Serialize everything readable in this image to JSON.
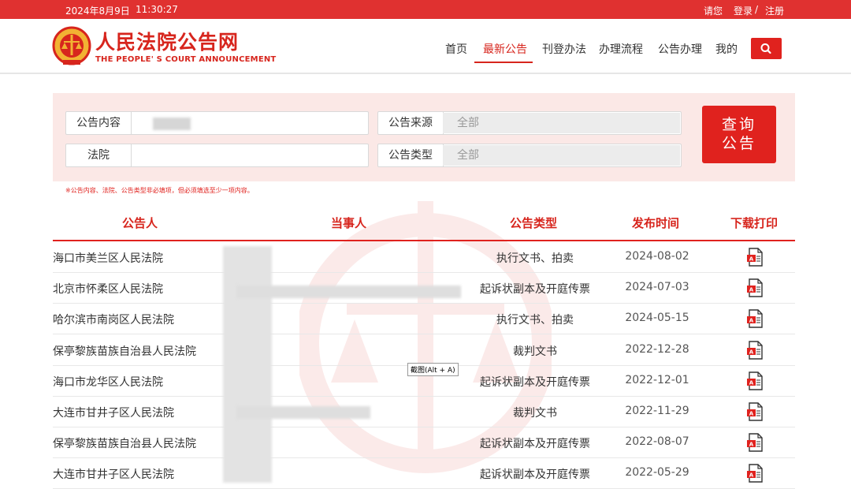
{
  "topbar": {
    "date": "2024年8月9日",
    "time": "11:30:27",
    "greeting": "请您",
    "login": "登录",
    "separator": "/",
    "register": "注册"
  },
  "brand": {
    "title": "人民法院公告网",
    "subtitle": "THE PEOPLE' S COURT ANNOUNCEMENT",
    "color": "#d7251d"
  },
  "nav": {
    "items": [
      "首页",
      "最新公告",
      "刊登办法",
      "办理流程",
      "公告办理",
      "我的"
    ],
    "active_index": 1
  },
  "search": {
    "content_label": "公告内容",
    "court_label": "法院",
    "source_label": "公告来源",
    "source_value": "全部",
    "type_label": "公告类型",
    "type_value": "全部",
    "query_button_line1": "查询",
    "query_button_line2": "公告",
    "note": "※公告内容、法院、公告类型非必填项，但必须填选至少一项内容。"
  },
  "table": {
    "headers": [
      "公告人",
      "当事人",
      "公告类型",
      "发布时间",
      "下载打印"
    ],
    "rows": [
      {
        "court": "海口市美兰区人民法院",
        "type": "执行文书、拍卖",
        "date": "2024-08-02"
      },
      {
        "court": "北京市怀柔区人民法院",
        "type": "起诉状副本及开庭传票",
        "date": "2024-07-03"
      },
      {
        "court": "哈尔滨市南岗区人民法院",
        "type": "执行文书、拍卖",
        "date": "2024-05-15"
      },
      {
        "court": "保亭黎族苗族自治县人民法院",
        "type": "裁判文书",
        "date": "2022-12-28"
      },
      {
        "court": "海口市龙华区人民法院",
        "type": "起诉状副本及开庭传票",
        "date": "2022-12-01"
      },
      {
        "court": "大连市甘井子区人民法院",
        "type": "裁判文书",
        "date": "2022-11-29"
      },
      {
        "court": "保亭黎族苗族自治县人民法院",
        "type": "起诉状副本及开庭传票",
        "date": "2022-08-07"
      },
      {
        "court": "大连市甘井子区人民法院",
        "type": "起诉状副本及开庭传票",
        "date": "2022-05-29"
      }
    ]
  },
  "tooltip": "截图(Alt + A)",
  "icons": {
    "search": "search-icon",
    "pdf": "pdf-icon",
    "emblem": "court-emblem-icon"
  },
  "colors": {
    "accent": "#e0221e",
    "panel": "#fbe8e6"
  }
}
